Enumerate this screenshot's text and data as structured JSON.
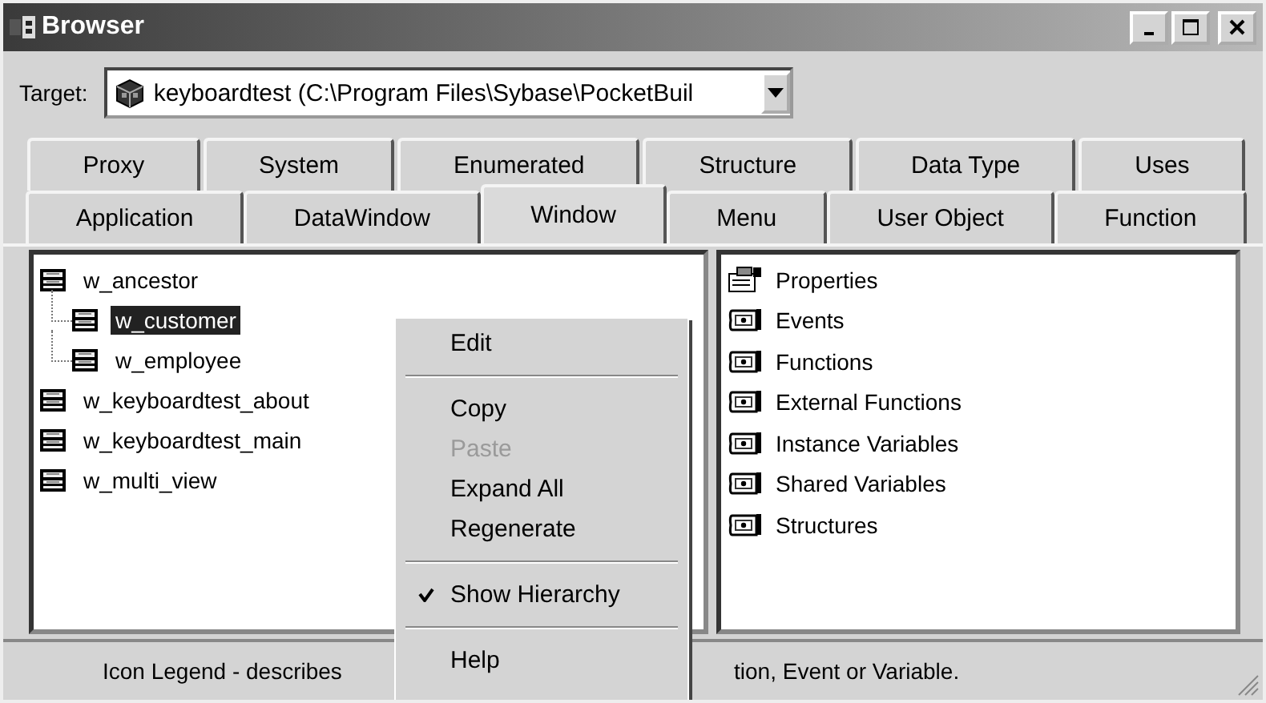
{
  "window": {
    "title": "Browser"
  },
  "target": {
    "label": "Target:",
    "value": "keyboardtest (C:\\Program Files\\Sybase\\PocketBuil"
  },
  "tab_rows": [
    [
      {
        "label": "Proxy",
        "selected": false
      },
      {
        "label": "System",
        "selected": false
      },
      {
        "label": "Enumerated",
        "selected": false
      },
      {
        "label": "Structure",
        "selected": false
      },
      {
        "label": "Data Type",
        "selected": false
      },
      {
        "label": "Uses",
        "selected": false
      }
    ],
    [
      {
        "label": "Application",
        "selected": false
      },
      {
        "label": "DataWindow",
        "selected": false
      },
      {
        "label": "Window",
        "selected": true
      },
      {
        "label": "Menu",
        "selected": false
      },
      {
        "label": "User Object",
        "selected": false
      },
      {
        "label": "Function",
        "selected": false
      }
    ]
  ],
  "tree": [
    {
      "label": "w_ancestor",
      "selected": false,
      "children": [
        {
          "label": "w_customer",
          "selected": true
        },
        {
          "label": "w_employee",
          "selected": false
        }
      ]
    },
    {
      "label": "w_keyboardtest_about",
      "selected": false
    },
    {
      "label": "w_keyboardtest_main",
      "selected": false
    },
    {
      "label": "w_multi_view",
      "selected": false
    }
  ],
  "members": [
    {
      "label": "Properties",
      "kind": "properties"
    },
    {
      "label": "Events",
      "kind": "events"
    },
    {
      "label": "Functions",
      "kind": "functions"
    },
    {
      "label": "External Functions",
      "kind": "external"
    },
    {
      "label": "Instance Variables",
      "kind": "instance"
    },
    {
      "label": "Shared Variables",
      "kind": "shared"
    },
    {
      "label": "Structures",
      "kind": "structures"
    }
  ],
  "context_menu": [
    {
      "kind": "item",
      "label": "Edit",
      "disabled": false,
      "checked": false
    },
    {
      "kind": "separator"
    },
    {
      "kind": "item",
      "label": "Copy",
      "disabled": false,
      "checked": false
    },
    {
      "kind": "item",
      "label": "Paste",
      "disabled": true,
      "checked": false
    },
    {
      "kind": "item",
      "label": "Expand All",
      "disabled": false,
      "checked": false
    },
    {
      "kind": "item",
      "label": "Regenerate",
      "disabled": false,
      "checked": false
    },
    {
      "kind": "separator"
    },
    {
      "kind": "item",
      "label": "Show Hierarchy",
      "disabled": false,
      "checked": true
    },
    {
      "kind": "separator"
    },
    {
      "kind": "item",
      "label": "Help",
      "disabled": false,
      "checked": false
    }
  ],
  "status_bar": {
    "left": "Icon Legend - describes",
    "right": "tion, Event or Variable."
  }
}
